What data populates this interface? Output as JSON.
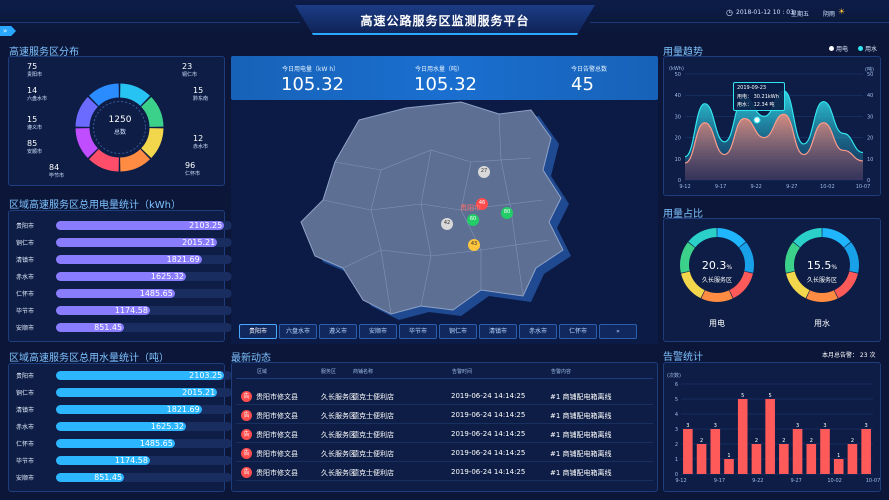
{
  "header": {
    "title": "高速公路服务区监测服务平台",
    "datetime": "2018-01-12  10 : 03",
    "weekday": "星期五",
    "weather": "阴雨"
  },
  "left": {
    "dist_title": "高速服务区分布",
    "donut_total": "1250",
    "donut_label": "总数",
    "cities": [
      {
        "value": "75",
        "name": "贵阳市"
      },
      {
        "value": "23",
        "name": "铜仁市"
      },
      {
        "value": "14",
        "name": "六盘水市"
      },
      {
        "value": "15",
        "name": "黔东南"
      },
      {
        "value": "15",
        "name": "遵义市"
      },
      {
        "value": "12",
        "name": "赤水市"
      },
      {
        "value": "85",
        "name": "安顺市"
      },
      {
        "value": "96",
        "name": "仁怀市"
      },
      {
        "value": "84",
        "name": "毕节市"
      }
    ],
    "elec_title": "区域高速服务区总用电量统计（kWh）",
    "elec": [
      {
        "name": "贵阳市",
        "value": "2103.25"
      },
      {
        "name": "铜仁市",
        "value": "2015.21"
      },
      {
        "name": "清镇市",
        "value": "1821.69"
      },
      {
        "name": "赤水市",
        "value": "1625.32"
      },
      {
        "name": "仁怀市",
        "value": "1485.65"
      },
      {
        "name": "毕节市",
        "value": "1174.58"
      },
      {
        "name": "安顺市",
        "value": "851.45"
      }
    ],
    "water_title": "区域高速服务区总用水量统计（吨）",
    "water": [
      {
        "name": "贵阳市",
        "value": "2103.25"
      },
      {
        "name": "铜仁市",
        "value": "2015.21"
      },
      {
        "name": "清镇市",
        "value": "1821.69"
      },
      {
        "name": "赤水市",
        "value": "1625.32"
      },
      {
        "name": "仁怀市",
        "value": "1485.65"
      },
      {
        "name": "毕节市",
        "value": "1174.58"
      },
      {
        "name": "安顺市",
        "value": "851.45"
      }
    ],
    "bar_colors": [
      "#8a7cff",
      "#2bb6ff"
    ]
  },
  "center": {
    "kpis": [
      {
        "label": "今日用电量（kW h）",
        "value": "105.32"
      },
      {
        "label": "今日用水量（吨）",
        "value": "105.32"
      },
      {
        "label": "今日告警总数",
        "value": "45"
      }
    ],
    "map_markers": [
      "27",
      "46",
      "60",
      "80",
      "42",
      "43"
    ],
    "map_city_label": "贵阳市",
    "city_tabs": [
      "贵阳市",
      "六盘水市",
      "遵义市",
      "安顺市",
      "毕节市",
      "铜仁市",
      "清镇市",
      "赤水市",
      "仁怀市",
      "»"
    ],
    "news_title": "最新动态",
    "news_headers": [
      "区域",
      "服务区",
      "商铺名称",
      "告警时间",
      "告警内容"
    ],
    "news_rows": [
      {
        "badge": "告",
        "area": "贵阳市修文县",
        "service": "久长服务区",
        "shop": "德克士便利店",
        "time": "2019-06-24   14:14:25",
        "content": "#1 商铺配电箱离线"
      },
      {
        "badge": "告",
        "area": "贵阳市修文县",
        "service": "久长服务区",
        "shop": "德克士便利店",
        "time": "2019-06-24   14:14:25",
        "content": "#1 商铺配电箱离线"
      },
      {
        "badge": "告",
        "area": "贵阳市修文县",
        "service": "久长服务区",
        "shop": "德克士便利店",
        "time": "2019-06-24   14:14:25",
        "content": "#1 商铺配电箱离线"
      },
      {
        "badge": "告",
        "area": "贵阳市修文县",
        "service": "久长服务区",
        "shop": "德克士便利店",
        "time": "2019-06-24   14:14:25",
        "content": "#1 商铺配电箱离线"
      },
      {
        "badge": "告",
        "area": "贵阳市修文县",
        "service": "久长服务区",
        "shop": "德克士便利店",
        "time": "2019-06-24   14:14:25",
        "content": "#1 商铺配电箱离线"
      }
    ]
  },
  "right": {
    "trend_title": "用量趋势",
    "legend": [
      "用电",
      "用水"
    ],
    "unit_left": "(kWh)",
    "unit_right": "(吨)",
    "tooltip": {
      "date": "2019-09-23",
      "elec": "用电： 30.21kWh",
      "water": "用水： 12.34 吨"
    },
    "ratio_title": "用量占比",
    "ratio": [
      {
        "pct": "20.3",
        "unit": "%",
        "sub": "久长服务区",
        "label": "用电"
      },
      {
        "pct": "15.5",
        "unit": "%",
        "sub": "久长服务区",
        "label": "用水"
      }
    ],
    "alarm_title": "告警统计",
    "alarm_month": "本月总告警： 23 次",
    "alarm_unit": "(次数)"
  },
  "chart_data": [
    {
      "type": "area",
      "title": "用量趋势",
      "x": [
        "9-12",
        "9-17",
        "9-22",
        "9-27",
        "10-02",
        "10-07"
      ],
      "ylim": [
        0,
        50
      ],
      "y2lim": [
        0,
        50
      ],
      "series": [
        {
          "name": "用电",
          "values": [
            11,
            36,
            18,
            39,
            30,
            42,
            17,
            37,
            22,
            13
          ]
        },
        {
          "name": "用水",
          "values": [
            8,
            27,
            12,
            29,
            20,
            31,
            12,
            27,
            14,
            9
          ]
        }
      ]
    },
    {
      "type": "bar",
      "title": "告警统计",
      "categories": [
        "9-12",
        "9-17",
        "9-22",
        "9-27",
        "10-02",
        "10-07"
      ],
      "values": [
        3,
        2,
        3,
        1,
        5,
        2,
        5,
        2,
        3,
        2,
        3,
        1,
        2,
        3
      ],
      "ylim": [
        0,
        6
      ],
      "color": "#ff5a5a"
    }
  ]
}
